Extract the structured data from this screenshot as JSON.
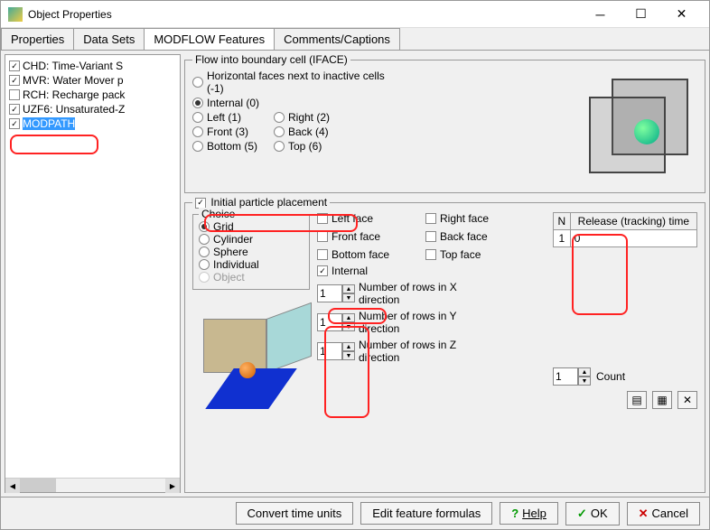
{
  "window": {
    "title": "Object Properties"
  },
  "tabs": [
    "Properties",
    "Data Sets",
    "MODFLOW Features",
    "Comments/Captions"
  ],
  "active_tab": 2,
  "tree": [
    {
      "label": "CHD: Time-Variant S",
      "checked": true
    },
    {
      "label": "MVR: Water Mover p",
      "checked": true
    },
    {
      "label": "RCH: Recharge pack",
      "checked": false
    },
    {
      "label": "UZF6: Unsaturated-Z",
      "checked": true
    },
    {
      "label": "MODPATH",
      "checked": true,
      "selected": true
    }
  ],
  "iface": {
    "legend": "Flow into boundary cell (IFACE)",
    "opts": [
      "Horizontal faces next to inactive cells (-1)",
      "Internal (0)",
      "Left (1)",
      "Right (2)",
      "Front (3)",
      "Back (4)",
      "Bottom (5)",
      "Top (6)"
    ],
    "selected": 1
  },
  "ipp": {
    "legend": "Initial particle placement",
    "checked": true,
    "choice_legend": "Choice",
    "choices": [
      "Grid",
      "Cylinder",
      "Sphere",
      "Individual",
      "Object"
    ],
    "choice_selected": 0,
    "faces": {
      "left": "Left face",
      "right": "Right face",
      "front": "Front face",
      "back": "Back face",
      "bottom": "Bottom face",
      "top": "Top face"
    },
    "internal_label": "Internal",
    "internal_checked": true,
    "rows": [
      {
        "val": "1",
        "label": "Number of rows in X direction"
      },
      {
        "val": "1",
        "label": "Number of rows in Y direction"
      },
      {
        "val": "1",
        "label": "Number of rows in Z direction"
      }
    ],
    "release": {
      "head_n": "N",
      "head_time": "Release (tracking) time",
      "rows": [
        {
          "n": "1",
          "time": "0"
        }
      ]
    },
    "count_val": "1",
    "count_label": "Count"
  },
  "footer": {
    "convert": "Convert time units",
    "edit": "Edit feature formulas",
    "help": "Help",
    "ok": "OK",
    "cancel": "Cancel"
  }
}
